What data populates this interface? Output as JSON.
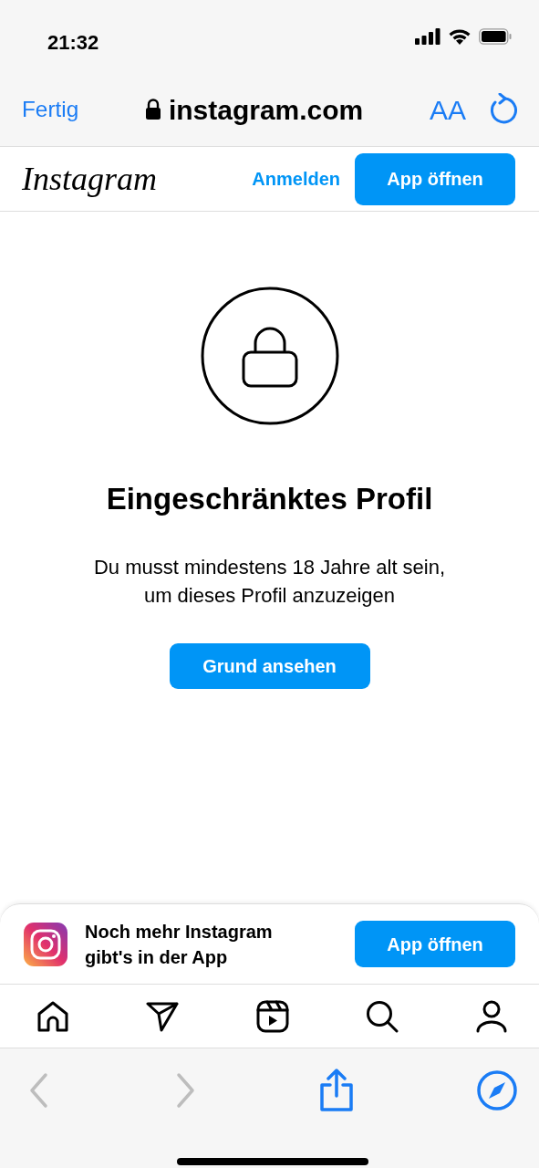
{
  "status_bar": {
    "time": "21:32"
  },
  "browser_bar": {
    "done": "Fertig",
    "address": "instagram.com",
    "text_size": "AA"
  },
  "header": {
    "logo": "Instagram",
    "login": "Anmelden",
    "open_app": "App öffnen"
  },
  "main": {
    "title": "Eingeschränktes Profil",
    "message": "Du musst mindestens 18 Jahre alt sein, um dieses Profil anzuzeigen",
    "button": "Grund ansehen"
  },
  "banner": {
    "text": "Noch mehr Instagram gibt's in der App",
    "button": "App öffnen"
  },
  "toolbar": [
    {
      "kind": "back",
      "disabled": true
    },
    {
      "kind": "forward",
      "disabled": true
    },
    {
      "kind": "share",
      "disabled": false
    },
    {
      "kind": "compass",
      "disabled": false
    }
  ]
}
